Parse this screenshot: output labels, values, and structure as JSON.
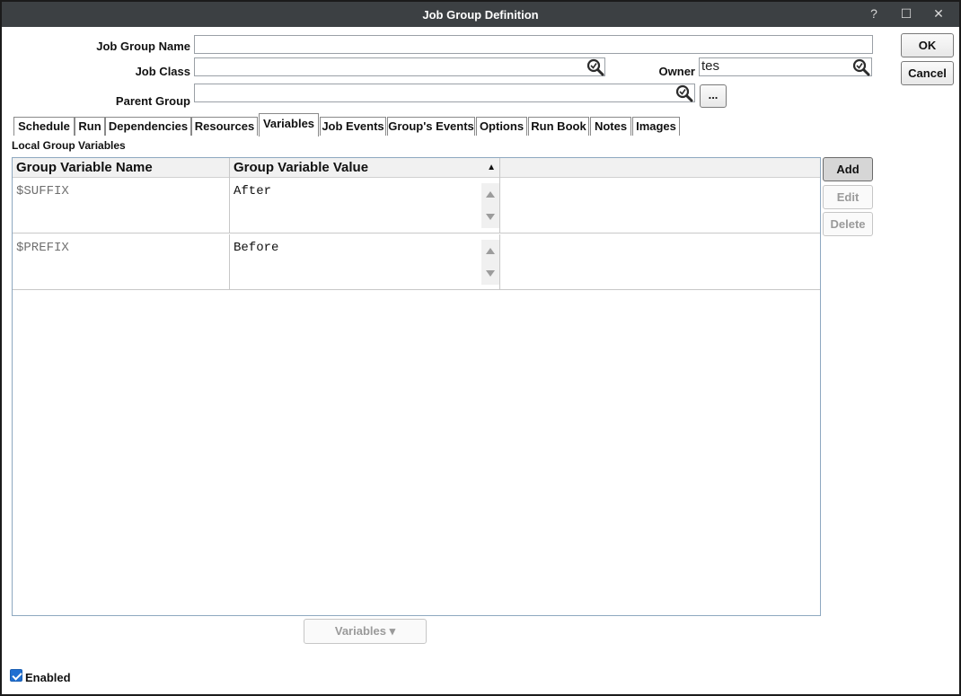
{
  "window": {
    "title": "Job Group Definition",
    "help_glyph": "?",
    "maximize_glyph": "☐",
    "close_glyph": "✕"
  },
  "form": {
    "job_group_name_label": "Job Group Name",
    "job_group_name_value": "",
    "job_class_label": "Job Class",
    "job_class_value": "",
    "owner_label": "Owner",
    "owner_value": "tes",
    "parent_group_label": "Parent Group",
    "parent_group_value": "",
    "browse_label": "..."
  },
  "actions": {
    "ok_label": "OK",
    "cancel_label": "Cancel"
  },
  "tabs": [
    {
      "label": "Schedule"
    },
    {
      "label": "Run"
    },
    {
      "label": "Dependencies"
    },
    {
      "label": "Resources"
    },
    {
      "label": "Variables"
    },
    {
      "label": "Job Events"
    },
    {
      "label": "Group's Events"
    },
    {
      "label": "Options"
    },
    {
      "label": "Run Book"
    },
    {
      "label": "Notes"
    },
    {
      "label": "Images"
    }
  ],
  "active_tab": "Variables",
  "variables": {
    "section_title": "Local Group Variables",
    "columns": [
      "Group Variable Name",
      "Group Variable Value"
    ],
    "sort_glyph": "▲",
    "rows": [
      {
        "name": "$SUFFIX",
        "value": "After"
      },
      {
        "name": "$PREFIX",
        "value": "Before"
      }
    ],
    "add_label": "Add",
    "edit_label": "Edit",
    "delete_label": "Delete",
    "variables_menu_label": "Variables ▾"
  },
  "footer": {
    "enabled_label": "Enabled",
    "enabled_checked": true
  },
  "colors": {
    "titlebar": "#3c4043",
    "checkbox": "#1f6fd1",
    "grid_border": "#8ea8c0"
  }
}
